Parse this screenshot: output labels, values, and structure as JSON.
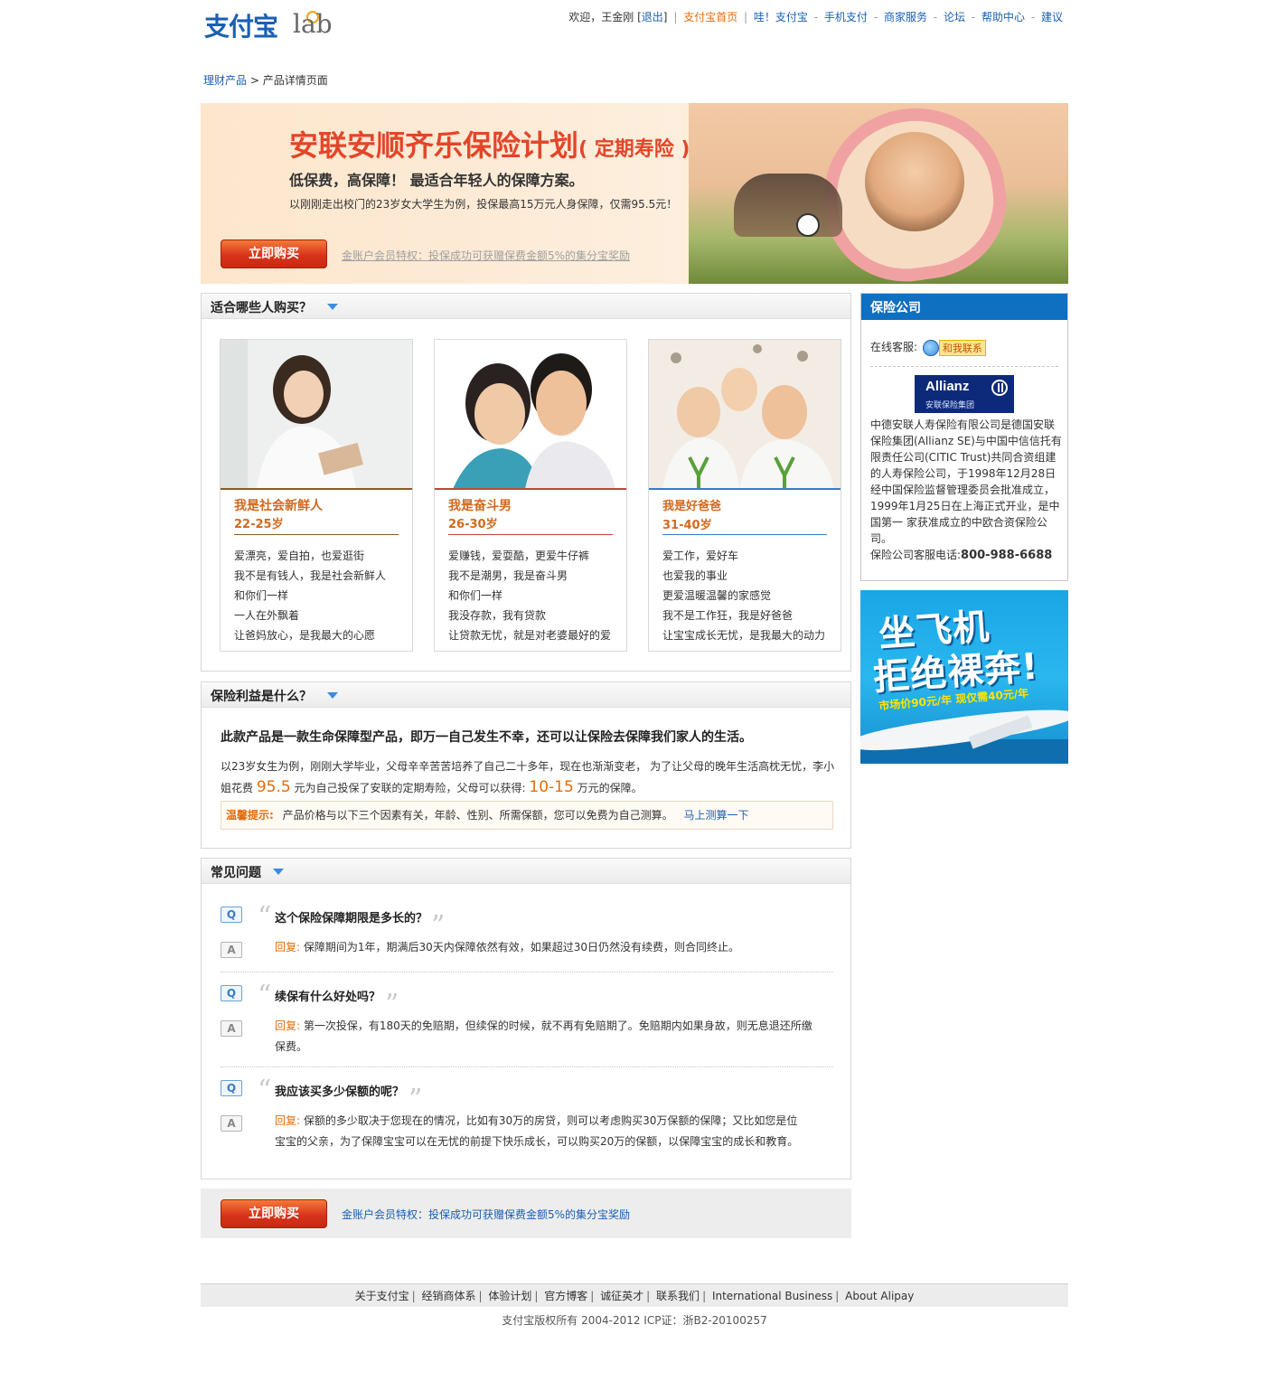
{
  "brand": {
    "logo_text": "支付宝",
    "lab_text": "lab"
  },
  "topnav": {
    "welcome": "欢迎，王金刚",
    "logout": "退出",
    "home": "支付宝首页",
    "links": [
      "哇！支付宝",
      "手机支付",
      "商家服务",
      "论坛",
      "帮助中心",
      "建议"
    ]
  },
  "breadcrumb": {
    "parent": "理财产品",
    "separator": ">",
    "current": "产品详情页面"
  },
  "banner": {
    "title": "安联安顺齐乐保险计划",
    "title_suffix": "( 定期寿险 )",
    "slogan": "低保费，高保障！ 最适合年轻人的保障方案。",
    "desc": "以刚刚走出校门的23岁女大学生为例，投保最高15万元人身保障，仅需95.5元！",
    "buy_label": "立即购买",
    "promo": "金账户会员特权：投保成功可获赠保费金额5%的集分宝奖励"
  },
  "who": {
    "title": "适合哪些人购买？",
    "cards": [
      {
        "name": "我是社会新鲜人",
        "age": "22-25岁",
        "lines": [
          "爱漂亮，爱自拍，也爱逛街",
          "我不是有钱人，我是社会新鲜人",
          "和你们一样",
          "一人在外飘着",
          "让爸妈放心，是我最大的心愿"
        ]
      },
      {
        "name": "我是奋斗男",
        "age": "26-30岁",
        "lines": [
          "爱赚钱，爱耍酷，更爱牛仔裤",
          "我不是潮男，我是奋斗男",
          "和你们一样",
          "我没存款，我有贷款",
          "让贷款无忧，就是对老婆最好的爱"
        ]
      },
      {
        "name": "我是好爸爸",
        "age": "31-40岁",
        "lines": [
          "爱工作，爱好车",
          "也爱我的事业",
          "更爱温暖温馨的家感觉",
          "我不是工作狂，我是好爸爸",
          "让宝宝成长无忧，是我最大的动力"
        ]
      }
    ]
  },
  "benefit": {
    "title": "保险利益是什么？",
    "lead": "此款产品是一款生命保障型产品，即万一自己发生不幸，还可以让保险去保障我们家人的生活。",
    "body_1": "以23岁女生为例，刚刚大学毕业，父母辛辛苦苦培养了自己二十多年，现在也渐渐变老， 为了让父母的晚年生活高枕无忧，李小姐花费 ",
    "amount": "95.5",
    "body_2": " 元为自己投保了安联的定期寿险，父母可以获得: ",
    "payout": "10-15",
    "body_3": " 万元的保障。",
    "tip_label": "温馨提示:",
    "tip_text": "产品价格与以下三个因素有关，年龄、性别、所需保额，您可以免费为自己测算。",
    "tip_link": "马上测算一下"
  },
  "faq": {
    "title": "常见问题",
    "reply_label": "回复:",
    "items": [
      {
        "q": "这个保险保障期限是多长的？",
        "a": "保障期间为1年，期满后30天内保障依然有效，如果超过30日仍然没有续费，则合同终止。"
      },
      {
        "q": "续保有什么好处吗？",
        "a": "第一次投保，有180天的免赔期，但续保的时候，就不再有免赔期了。免赔期内如果身故，则无息退还所缴保费。"
      },
      {
        "q": "我应该买多少保额的呢？",
        "a": "保额的多少取决于您现在的情况，比如有30万的房贷，则可以考虑购买30万保额的保障；又比如您是位宝宝的父亲，为了保障宝宝可以在无忧的前提下快乐成长，可以购买20万的保额，以保障宝宝的成长和教育。"
      }
    ]
  },
  "bottom_bar": {
    "buy_label": "立即购买",
    "promo": "金账户会员特权：投保成功可获赠保费金额5%的集分宝奖励"
  },
  "sidebar": {
    "title": "保险公司",
    "service_label": "在线客服:",
    "contact_label": "和我联系",
    "allianz_name": "Allianz",
    "allianz_cn": "安联保险集团",
    "desc": "中德安联人寿保险有限公司是德国安联保险集团(Allianz SE)与中国中信信托有限责任公司(CITIC Trust)共同合资组建的人寿保险公司，于1998年12月28日经中国保险监督管理委员会批准成立，1999年1月25日在上海正式开业，是中国第一 家获准成立的中欧合资保险公司。",
    "phone_label": "保险公司客服电话:",
    "phone": "800-988-6688"
  },
  "ad": {
    "line1": "坐飞机",
    "line2": "拒绝裸奔!",
    "price": "市场价90元/年 现仅需40元/年"
  },
  "footer": {
    "links": [
      "关于支付宝",
      "经销商体系",
      "体验计划",
      "官方博客",
      "诚征英才",
      "联系我们",
      "International Business",
      "About Alipay"
    ],
    "copyright": "支付宝版权所有 2004-2012 ICP证：浙B2-20100257"
  },
  "colors": {
    "brand_blue": "#1a5fb4",
    "accent_orange": "#e46c0a",
    "banner_red": "#e2462a",
    "sidebar_blue": "#0f6fc0"
  }
}
